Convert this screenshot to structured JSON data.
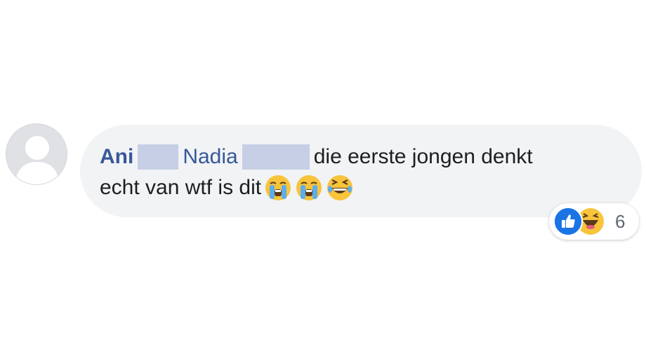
{
  "comment": {
    "author": "Ani",
    "mention": "Nadia",
    "text_line1": "die eerste jongen denkt",
    "text_line2": "echt van wtf is dit",
    "emojis": [
      "loudly-crying-face-icon",
      "loudly-crying-face-icon",
      "grinning-squinting-face-icon"
    ]
  },
  "reactions": {
    "types": [
      "like-reaction-icon",
      "haha-reaction-icon"
    ],
    "count": "6"
  },
  "colors": {
    "bubble": "#f2f3f5",
    "author": "#385898",
    "redaction": "#c7cfe6",
    "like_blue": "#1b74e4",
    "emoji_yellow": "#f7c43b"
  }
}
